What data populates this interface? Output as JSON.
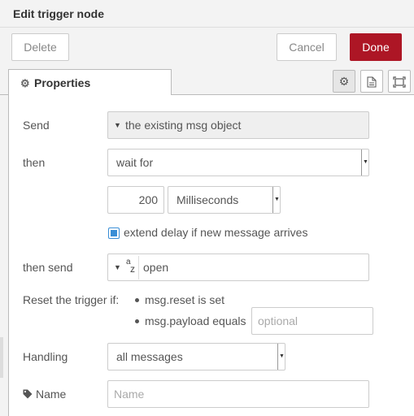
{
  "dialog": {
    "title": "Edit trigger node",
    "delete_label": "Delete",
    "cancel_label": "Cancel",
    "done_label": "Done"
  },
  "tabs": {
    "properties_label": "Properties",
    "icons": [
      "gear-icon",
      "document-icon",
      "frame-icon"
    ]
  },
  "form": {
    "send_label": "Send",
    "send_value": "the existing msg object",
    "then_label": "then",
    "then_value": "wait for",
    "delay_value": "200",
    "delay_units": "Milliseconds",
    "extend_label": "extend delay if new message arrives",
    "extend_checked": true,
    "then_send_label": "then send",
    "then_send_value": "open",
    "reset_label": "Reset the trigger if:",
    "reset_option1": "msg.reset is set",
    "reset_option2": "msg.payload equals",
    "reset_placeholder": "optional",
    "handling_label": "Handling",
    "handling_value": "all messages",
    "name_label": "Name",
    "name_placeholder": "Name"
  },
  "colors": {
    "primary": "#ad1625",
    "checkbox_accent": "#3a8ed6"
  }
}
